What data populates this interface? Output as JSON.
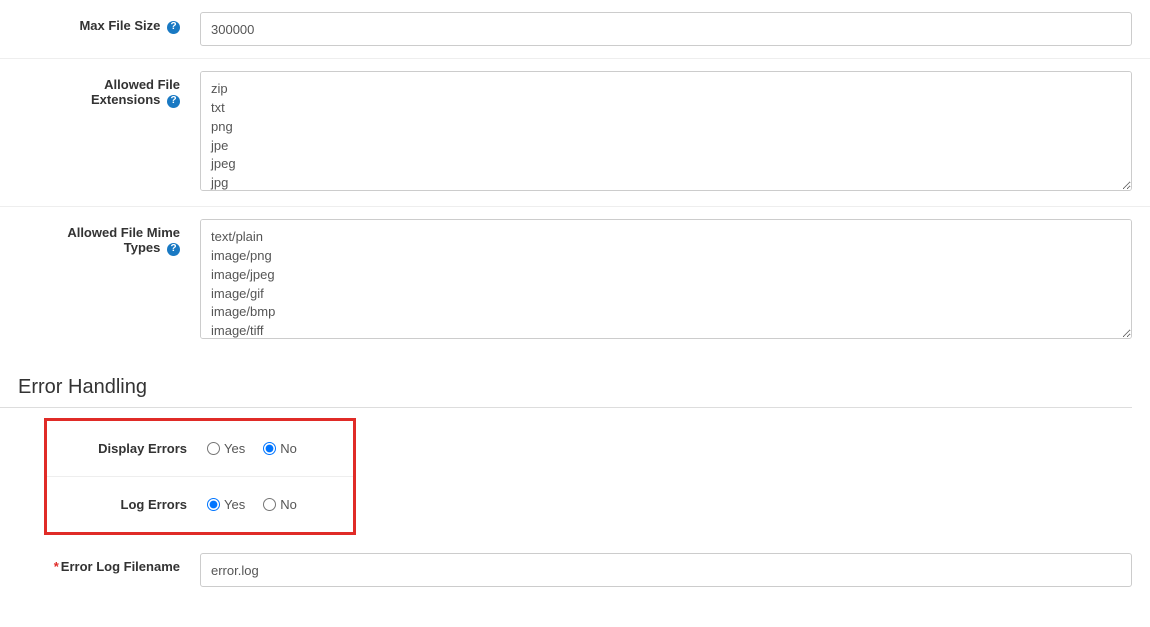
{
  "fields": {
    "maxFileSize": {
      "label": "Max File Size",
      "value": "300000"
    },
    "allowedExtensions": {
      "label_l1": "Allowed File",
      "label_l2": "Extensions",
      "value": "zip\ntxt\npng\njpe\njpeg\njpg"
    },
    "allowedMime": {
      "label_l1": "Allowed File Mime",
      "label_l2": "Types",
      "value": "text/plain\nimage/png\nimage/jpeg\nimage/gif\nimage/bmp\nimage/tiff"
    },
    "displayErrors": {
      "label": "Display Errors"
    },
    "logErrors": {
      "label": "Log Errors"
    },
    "errorLogFilename": {
      "label": "Error Log Filename",
      "value": "error.log"
    }
  },
  "section": {
    "errorHandling": "Error Handling"
  },
  "options": {
    "yes": "Yes",
    "no": "No"
  },
  "helpGlyph": "?"
}
